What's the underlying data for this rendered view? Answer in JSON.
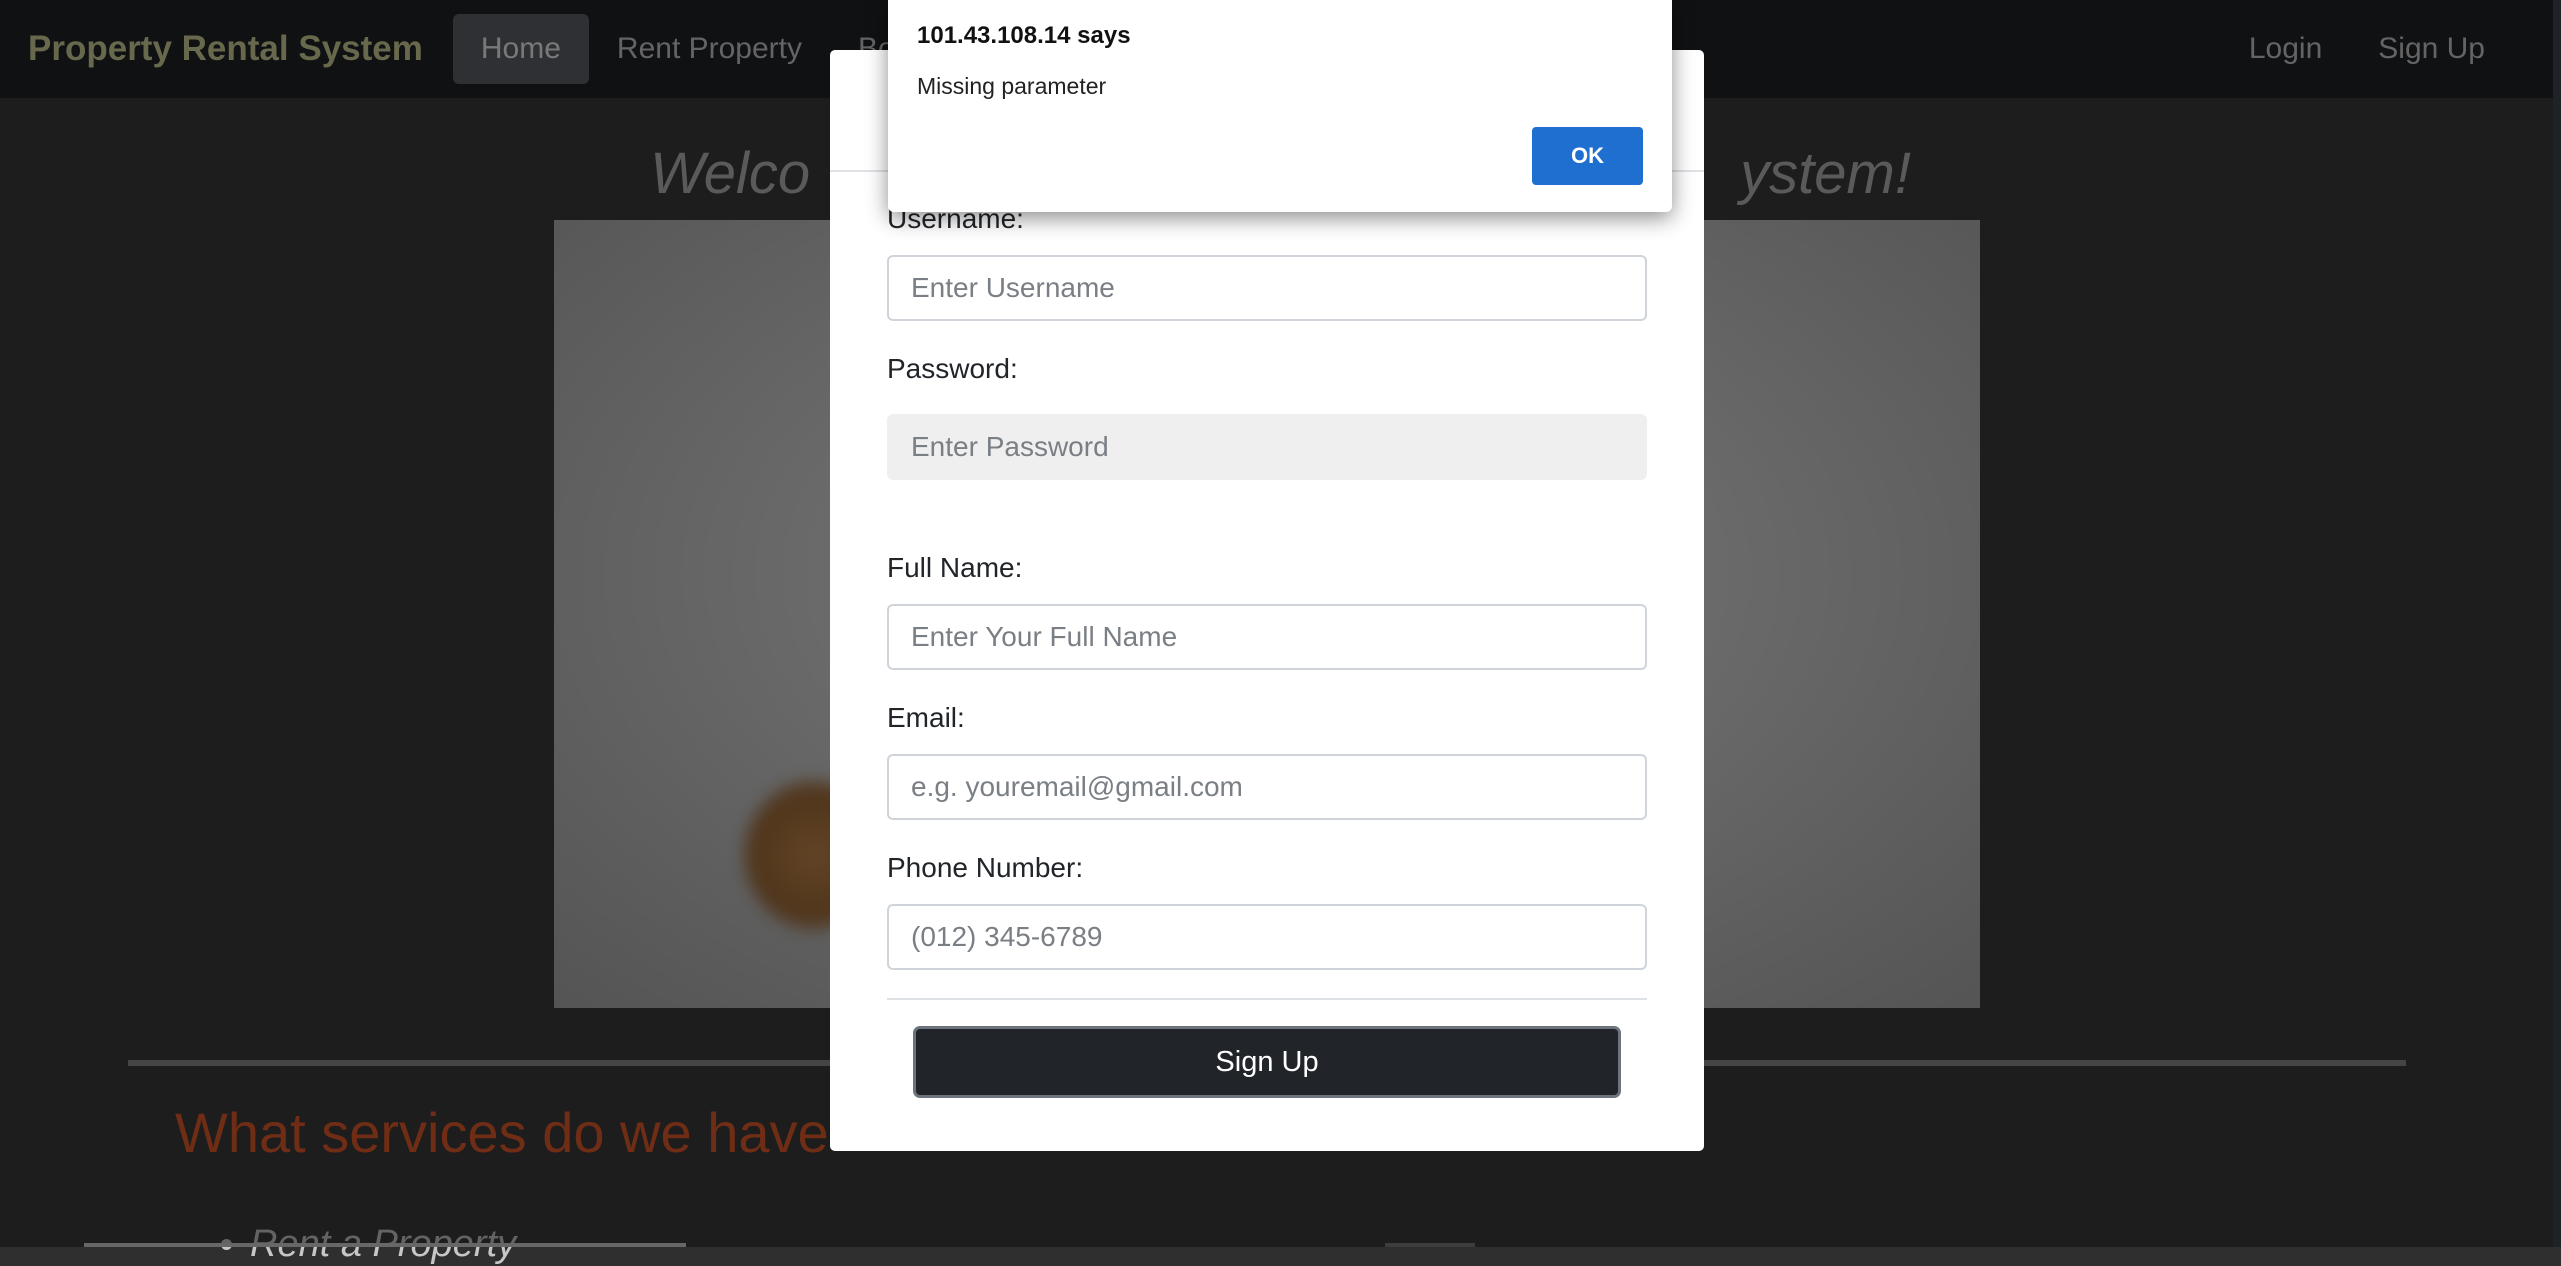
{
  "navbar": {
    "brand": "Property Rental System",
    "links": [
      {
        "label": "Home",
        "active": true
      },
      {
        "label": "Rent Property",
        "active": false
      },
      {
        "label": "Boo",
        "active": false
      }
    ],
    "right_links": [
      {
        "label": "Login"
      },
      {
        "label": "Sign Up"
      }
    ]
  },
  "page": {
    "welcome_left": "Welco",
    "welcome_right": "ystem!",
    "services_title": "What services do we have",
    "services": [
      "Rent a Property"
    ]
  },
  "signup_modal": {
    "fields": [
      {
        "label": "Username:",
        "placeholder": "Enter Username",
        "value": ""
      },
      {
        "label": "Password:",
        "placeholder": "Enter Password",
        "value": ""
      },
      {
        "label": "Full Name:",
        "placeholder": "Enter Your Full Name",
        "value": ""
      },
      {
        "label": "Email:",
        "placeholder": "e.g. youremail@gmail.com",
        "value": ""
      },
      {
        "label": "Phone Number:",
        "placeholder": "(012) 345-6789",
        "value": ""
      }
    ],
    "submit_label": "Sign Up"
  },
  "alert": {
    "title": "101.43.108.14 says",
    "message": "Missing parameter",
    "ok_label": "OK"
  },
  "colors": {
    "navbar_bg": "#1f2226",
    "brand": "#d1d09a",
    "accent_button": "#212529",
    "alert_button": "#1f6fd1",
    "services_title": "#e05a2a"
  }
}
